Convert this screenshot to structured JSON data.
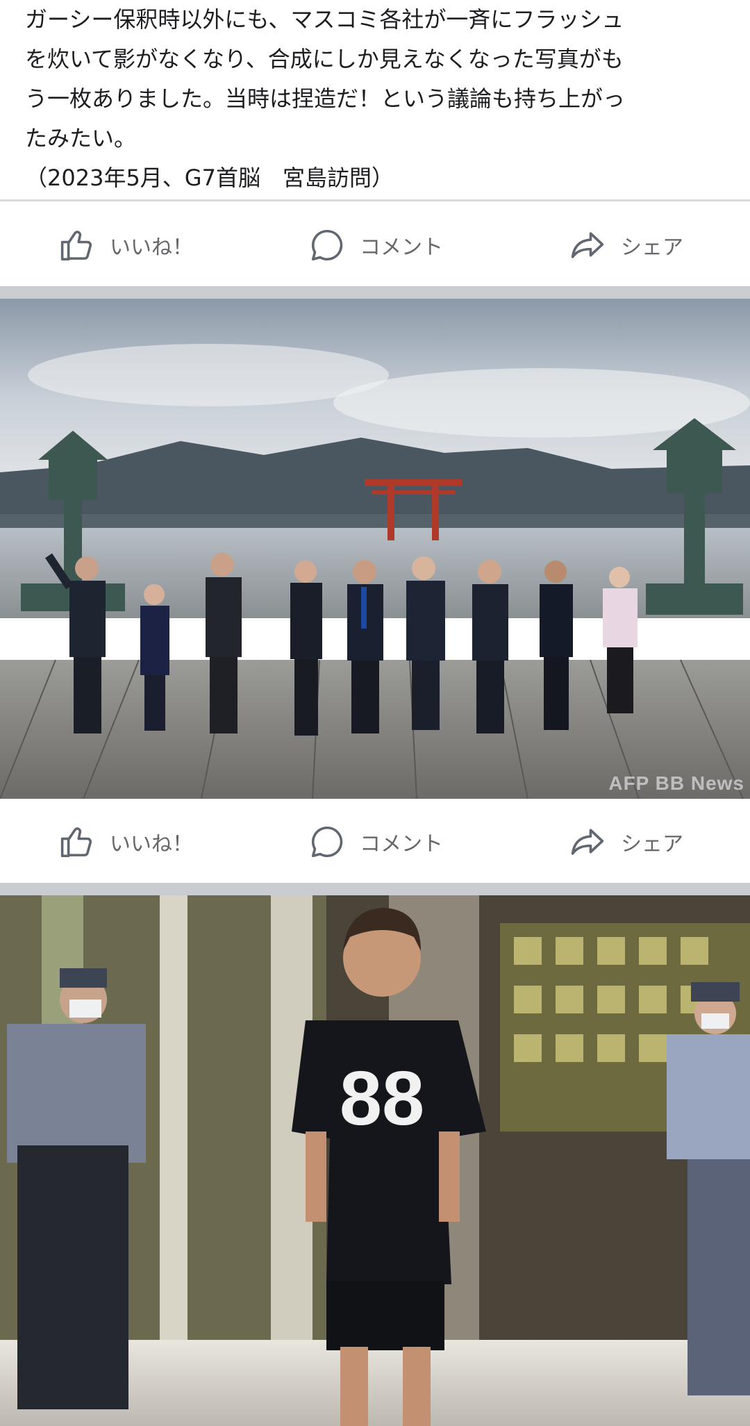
{
  "post": {
    "lines": [
      "ガーシー保釈時以外にも、マスコミ各社が一斉にフラッシュ",
      "を炊いて影がなくなり、合成にしか見えなくなった写真がも",
      "う一枚ありました。当時は捏造だ！という議論も持ち上がっ",
      "たみたい。"
    ],
    "caption": "（2023年5月、G7首脳　宮島訪問）"
  },
  "actions": {
    "like_label": "いいね！",
    "comment_label": "コメント",
    "share_label": "シェア"
  },
  "photo1": {
    "watermark": "AFP BB News"
  },
  "photo2": {
    "shirt_number": "88"
  },
  "colors": {
    "text": "#1c1e21",
    "action_text": "#65676b",
    "separator": "#c9ccd1"
  }
}
